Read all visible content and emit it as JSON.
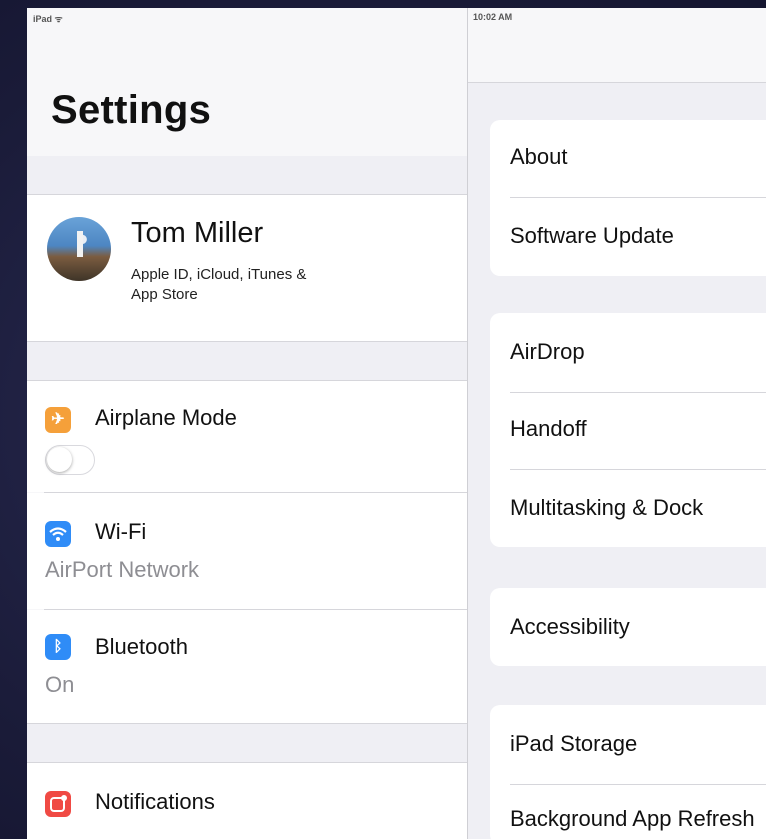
{
  "status_bar": {
    "carrier": "iPad ᯤ",
    "time": "10:02 AM"
  },
  "master": {
    "title": "Settings",
    "profile": {
      "name": "Tom Miller",
      "subtitle_line1": "Apple ID, iCloud, iTunes &",
      "subtitle_line2": "App Store"
    },
    "items": [
      {
        "label": "Airplane Mode",
        "icon": "airplane-icon",
        "icon_color": "#f5a03a",
        "toggle": false
      },
      {
        "label": "Wi-Fi",
        "value": "AirPort Network",
        "icon": "wifi-icon",
        "icon_color": "#2f8cf7"
      },
      {
        "label": "Bluetooth",
        "value": "On",
        "icon": "bluetooth-icon",
        "icon_color": "#2f8cf7"
      },
      {
        "label": "Notifications",
        "icon": "notifications-icon",
        "icon_color": "#f04a44"
      }
    ]
  },
  "detail": {
    "group1": [
      "About",
      "Software Update"
    ],
    "group2": [
      "AirDrop",
      "Handoff",
      "Multitasking & Dock"
    ],
    "group3": [
      "Accessibility"
    ],
    "group4": [
      "iPad Storage",
      "Background App Refresh"
    ]
  }
}
